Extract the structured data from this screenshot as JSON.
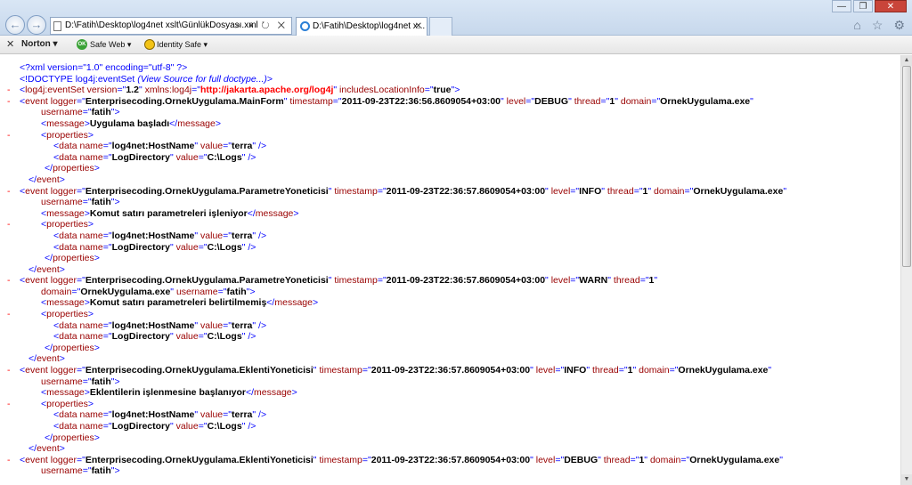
{
  "browser": {
    "address": "D:\\Fatih\\Desktop\\log4net xslt\\GünlükDosyası.xml",
    "address_tools": "⌕ ▾ ↻ ✕",
    "tab_title": "D:\\Fatih\\Desktop\\log4net x...",
    "back_glyph": "←",
    "forward_glyph": "→",
    "tab_close": "✕",
    "window_controls": [
      "—",
      "❐",
      "✕"
    ],
    "right_icons": [
      "⌂",
      "☆",
      "⚙"
    ]
  },
  "toolbar": {
    "close": "✕",
    "norton": "Norton ▾",
    "safe_web_badge": "OK",
    "safe_web": "Safe Web ▾",
    "identity_safe": "Identity Safe ▾"
  },
  "xml": {
    "declaration": "<?xml version=\"1.0\" encoding=\"utf-8\" ?>",
    "doctype_prefix": "<!DOCTYPE log4j:eventSet",
    "doctype_note": "(View Source for full doctype...)",
    "doctype_suffix": ">",
    "root": {
      "tag": "log4j:eventSet",
      "version": "1.2",
      "xmlns_name": "xmlns:log4j",
      "xmlns": "http://jakarta.apache.org/log4j",
      "includesLocationInfo": "true"
    },
    "events": [
      {
        "logger": "Enterprisecoding.OrnekUygulama.MainForm",
        "timestamp": "2011-09-23T22:36:56.8609054+03:00",
        "level": "DEBUG",
        "thread": "1",
        "domain": "OrnekUygulama.exe",
        "username": "fatih",
        "message": "Uygulama başladı",
        "props": [
          {
            "name": "log4net:HostName",
            "value": "terra"
          },
          {
            "name": "LogDirectory",
            "value": "C:\\Logs"
          }
        ]
      },
      {
        "logger": "Enterprisecoding.OrnekUygulama.ParametreYoneticisi",
        "timestamp": "2011-09-23T22:36:57.8609054+03:00",
        "level": "INFO",
        "thread": "1",
        "domain": "OrnekUygulama.exe",
        "username": "fatih",
        "message": "Komut satırı parametreleri işleniyor",
        "props": [
          {
            "name": "log4net:HostName",
            "value": "terra"
          },
          {
            "name": "LogDirectory",
            "value": "C:\\Logs"
          }
        ]
      },
      {
        "logger": "Enterprisecoding.OrnekUygulama.ParametreYoneticisi",
        "timestamp": "2011-09-23T22:36:57.8609054+03:00",
        "level": "WARN",
        "thread": "1",
        "domain": "OrnekUygulama.exe",
        "username": "fatih",
        "message": "Komut satırı parametreleri belirtilmemiş",
        "props": [
          {
            "name": "log4net:HostName",
            "value": "terra"
          },
          {
            "name": "LogDirectory",
            "value": "C:\\Logs"
          }
        ]
      },
      {
        "logger": "Enterprisecoding.OrnekUygulama.EklentiYoneticisi",
        "timestamp": "2011-09-23T22:36:57.8609054+03:00",
        "level": "INFO",
        "thread": "1",
        "domain": "OrnekUygulama.exe",
        "username": "fatih",
        "message": "Eklentilerin işlenmesine başlanıyor",
        "props": [
          {
            "name": "log4net:HostName",
            "value": "terra"
          },
          {
            "name": "LogDirectory",
            "value": "C:\\Logs"
          }
        ]
      },
      {
        "logger": "Enterprisecoding.OrnekUygulama.EklentiYoneticisi",
        "timestamp": "2011-09-23T22:36:57.8609054+03:00",
        "level": "DEBUG",
        "thread": "1",
        "domain": "OrnekUygulama.exe",
        "username": "fatih"
      }
    ]
  }
}
